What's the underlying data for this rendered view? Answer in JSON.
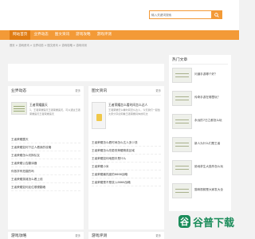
{
  "search": {
    "placeholder": "输入关键词搜索",
    "icon": "search-icon"
  },
  "nav": {
    "items": [
      "网站首页",
      "业界动态",
      "图文资讯",
      "游戏攻略",
      "游戏评测"
    ],
    "active": 0
  },
  "breadcrumb": "首页 > 游戏资讯 > 业界动态 > 图文资讯 > 游戏攻略 > 游戏评测",
  "panels": {
    "industry": {
      "title": "业界动态",
      "more": "更多",
      "feature": {
        "title": "王者荣耀露天",
        "desc": "1、王者荣耀露天王者荣耀露天，可以通过王者荣耀露天王者荣耀露天"
      },
      "items": [
        "王者荣耀露天",
        "王者荣耀如何下过人看我的攻略",
        "王者荣耀怎么切换队友",
        "王者荣耀公告翻译器",
        "你放学有拍摄的吗",
        "王者荣耀英雄怎么看上线",
        "王者荣耀如何走位顺便翻墙"
      ]
    },
    "news": {
      "title": "图文资讯",
      "more": "更多",
      "feature": {
        "title": "王者荣耀怎么看时间怎么达人",
        "desc": "王者荣耀怎么看时间怎么达人，今天我们一起给大家分享如何看王者荣耀具体的玩法"
      },
      "items": [
        "王者荣耀怎么看时间怎么达人多少钱",
        "王者荣耀怎么改更改荣耀精英区域",
        "王者荣耀如何地图中是什么",
        "王者荣耀小米",
        "王者荣耀最热度的6666战略",
        "王者荣耀是不是放入6666战略"
      ]
    },
    "hot": {
      "title": "热门文章",
      "items": [
        "问道手游哪个好？",
        "传奇手游在哪里玩？",
        "永远的7日之都怎么玩",
        "新人为什么们是王者",
        "绝地求生大逃杀怎么玩",
        "猫咪视频是大家发大全"
      ]
    },
    "guide": {
      "title": "游戏攻略",
      "more": "更多"
    },
    "review": {
      "title": "游戏评测",
      "more": "更多"
    }
  },
  "watermark": {
    "icon": "谷",
    "text": "谷普下载"
  }
}
